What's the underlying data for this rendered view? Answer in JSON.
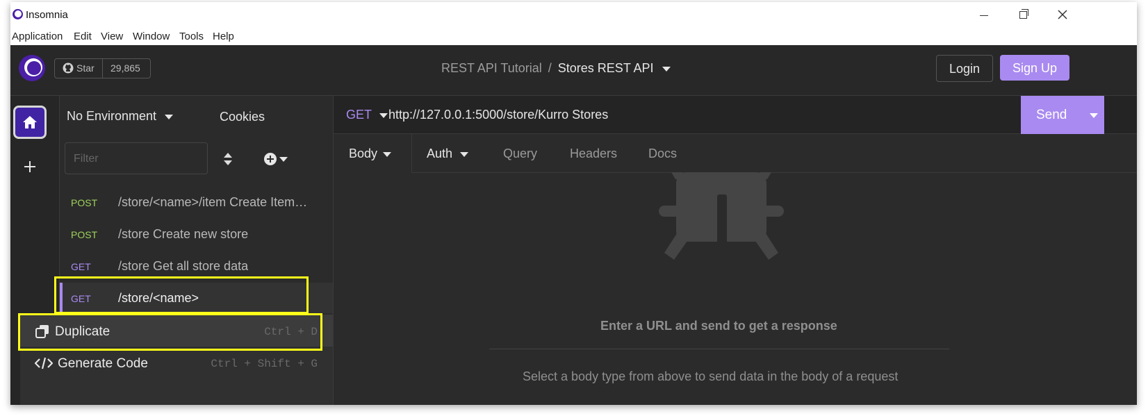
{
  "window": {
    "title": "Insomnia",
    "controls": [
      "minimize",
      "restore",
      "close"
    ]
  },
  "menu": [
    "Application",
    "Edit",
    "View",
    "Window",
    "Tools",
    "Help"
  ],
  "header": {
    "github_star_label": "Star",
    "github_star_count": "29,865",
    "breadcrumb_project": "REST API Tutorial",
    "breadcrumb_sep": "/",
    "breadcrumb_collection": "Stores REST API",
    "login_label": "Login",
    "signup_label": "Sign Up"
  },
  "sidebar": {
    "environment_label": "No Environment",
    "cookies_label": "Cookies",
    "filter_placeholder": "Filter",
    "requests": [
      {
        "method": "POST",
        "label": "/store/<name>/item Create Item…"
      },
      {
        "method": "POST",
        "label": "/store Create new store"
      },
      {
        "method": "GET",
        "label": "/store Get all store data"
      },
      {
        "method": "GET",
        "label": "/store/<name>"
      }
    ]
  },
  "context_menu": {
    "items": [
      {
        "label": "Duplicate",
        "shortcut": "Ctrl + D"
      },
      {
        "label": "Generate Code",
        "shortcut": "Ctrl + Shift + G"
      }
    ]
  },
  "request": {
    "method": "GET",
    "url": "http://127.0.0.1:5000/store/Kurro Stores",
    "send_label": "Send",
    "tabs": [
      "Body",
      "Auth",
      "Query",
      "Headers",
      "Docs"
    ]
  },
  "response": {
    "hint_title": "Enter a URL and send to get a response",
    "hint_body": "Select a body type from above to send data in the body of a request"
  },
  "colors": {
    "accent": "#a98af0",
    "post_method": "#9fd35a",
    "get_method": "#a98af0",
    "highlight": "#ffff1a"
  }
}
